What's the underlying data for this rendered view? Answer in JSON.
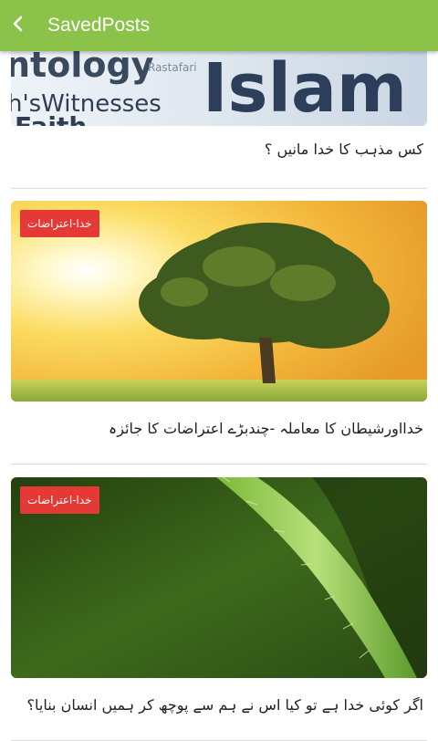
{
  "app_bar": {
    "title": "SavedPosts",
    "back_icon": "chevron-left-icon",
    "color": "#8bc34a"
  },
  "posts": [
    {
      "image_words": [
        "ntology",
        "Rastafari",
        "Islam",
        "h'sWitnesses",
        "Faith"
      ],
      "title": "کس مذہب کا خدا مانیں ؟"
    },
    {
      "badge": "خدا-اعتراضات",
      "title": "خدااورشیطان کا معاملہ -چندبڑے اعتراضات کا جائزہ"
    },
    {
      "badge": "خدا-اعتراضات",
      "title": "اگر کوئی خدا ہے تو کیا اس نے ہم سے پوچھ کر ہمیں انسان بنایا؟"
    }
  ],
  "colors": {
    "badge": "#e53935",
    "divider": "#dddddd"
  }
}
